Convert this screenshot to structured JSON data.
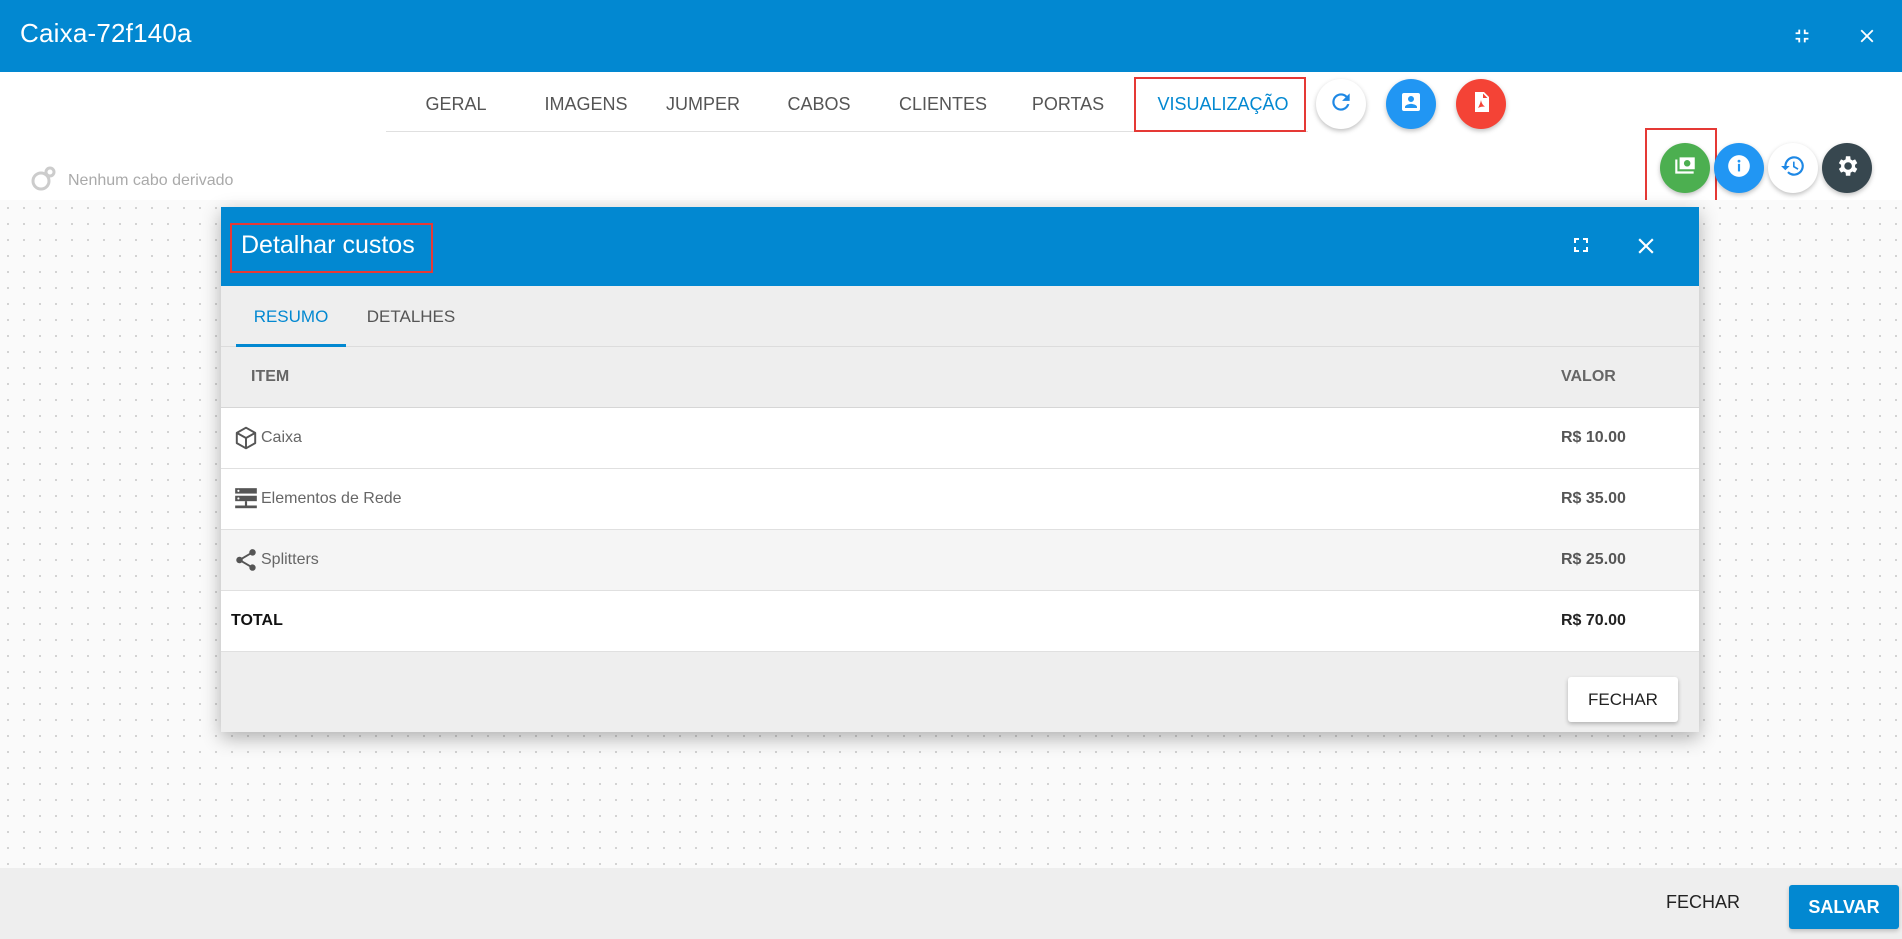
{
  "window": {
    "title": "Caixa-72f140a",
    "collapse_icon": "fullscreen-exit-icon",
    "close_icon": "close-icon"
  },
  "tabs": [
    {
      "label": "GERAL"
    },
    {
      "label": "IMAGENS"
    },
    {
      "label": "JUMPER"
    },
    {
      "label": "CABOS"
    },
    {
      "label": "CLIENTES"
    },
    {
      "label": "PORTAS"
    },
    {
      "label": "VISUALIZAÇÃO",
      "active": true
    }
  ],
  "tab_actions": [
    {
      "name": "refresh-icon",
      "color": "#ffffff"
    },
    {
      "name": "contact-icon",
      "color": "#2196f3"
    },
    {
      "name": "pdf-icon",
      "color": "#f44336"
    }
  ],
  "subbar": {
    "no_cable_text": "Nenhum cabo derivado"
  },
  "fab_actions": [
    {
      "name": "costs-icon",
      "color": "#4caf50"
    },
    {
      "name": "info-icon",
      "color": "#2196f3"
    },
    {
      "name": "history-icon",
      "color": "#ffffff"
    },
    {
      "name": "settings-icon",
      "color": "#37474f"
    }
  ],
  "dialog": {
    "title": "Detalhar custos",
    "tabs": [
      {
        "label": "RESUMO",
        "active": true
      },
      {
        "label": "DETALHES"
      }
    ],
    "columns": {
      "item": "ITEM",
      "value": "VALOR"
    },
    "rows": [
      {
        "icon": "box-icon",
        "label": "Caixa",
        "value": "R$ 10.00"
      },
      {
        "icon": "server-icon",
        "label": "Elementos de Rede",
        "value": "R$ 35.00"
      },
      {
        "icon": "share-icon",
        "label": "Splitters",
        "value": "R$ 25.00"
      }
    ],
    "total": {
      "label": "TOTAL",
      "value": "R$ 70.00"
    },
    "close_label": "FECHAR"
  },
  "footer": {
    "close_label": "FECHAR",
    "save_label": "SALVAR"
  },
  "colors": {
    "primary": "#0288d1",
    "highlight": "#e53935"
  }
}
